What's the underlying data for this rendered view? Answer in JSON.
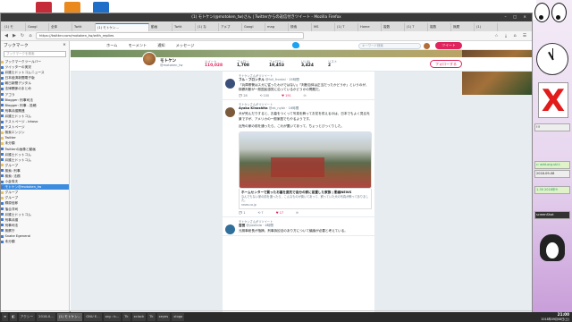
{
  "window": {
    "title": "(1) モトケン(@motoken_tw)さん | Twitterからの返信付きツイート - Mozilla Firefox",
    "controls": "– □ ×"
  },
  "tabs": [
    {
      "label": "(1) モ"
    },
    {
      "label": "Googl"
    },
    {
      "label": "全体"
    },
    {
      "label": "Twitt"
    },
    {
      "label": "(1) モトケン..."
    },
    {
      "label": "動画"
    },
    {
      "label": "Twitt"
    },
    {
      "label": "(1) な"
    },
    {
      "label": "アメブ"
    },
    {
      "label": "Googl"
    },
    {
      "label": "mag"
    },
    {
      "label": "検索"
    },
    {
      "label": "MS"
    },
    {
      "label": "(1) T"
    },
    {
      "label": "Home"
    },
    {
      "label": "複数"
    },
    {
      "label": "(1) T"
    },
    {
      "label": "複数"
    },
    {
      "label": "無題"
    },
    {
      "label": "(1) "
    }
  ],
  "navbar": {
    "url": "https://twitter.com/motoken_tw/with_replies",
    "back": "◀",
    "forward": "▶",
    "reload": "↻",
    "home": "⌂",
    "tools": "☆ ⤓ ⌂ ☰"
  },
  "sidebar": {
    "title": "ブックマーク",
    "close": "×",
    "search_placeholder": "ブックマークを検索",
    "items": [
      {
        "label": "ブックマークツールバー",
        "folder": true
      },
      {
        "label": "ツイッターの実況",
        "folder": false
      },
      {
        "label": "弁護士ドットコムニュース",
        "folder": false
      },
      {
        "label": "日本経済新聞電子版",
        "folder": false
      },
      {
        "label": "朝日新聞デジタル",
        "folder": false
      },
      {
        "label": "法律関係のまとめ",
        "folder": false
      },
      {
        "label": "アゴラ",
        "folder": false
      },
      {
        "label": "Blogger: 刑事司法",
        "folder": false
      },
      {
        "label": "Blogger: 刑事 - 投稿",
        "folder": false
      },
      {
        "label": "刑事弁護関連",
        "folder": false
      },
      {
        "label": "弁護士ドットコム",
        "folder": false
      },
      {
        "label": "テストページ - bhoso",
        "folder": false
      },
      {
        "label": "テストページ",
        "folder": false
      },
      {
        "label": "検索エンジン",
        "folder": true
      },
      {
        "label": "Twitter",
        "folder": true
      },
      {
        "label": "未分類",
        "folder": true
      },
      {
        "label": "Twitterの画像と動画",
        "folder": false
      },
      {
        "label": "弁護士ドットコム",
        "folder": false
      },
      {
        "label": "弁護士ドットコム",
        "folder": false
      },
      {
        "label": "グループ",
        "folder": true
      },
      {
        "label": "検索: 刑事",
        "folder": false
      },
      {
        "label": "検索: 法務",
        "folder": false
      },
      {
        "label": "小倉秀夫",
        "folder": false
      },
      {
        "label": "モトケン@motoken_tw",
        "folder": false,
        "selected": true
      },
      {
        "label": "グループ",
        "folder": true
      },
      {
        "label": "グループ",
        "folder": true
      },
      {
        "label": "郷原信郎",
        "folder": false
      },
      {
        "label": "落合洋司",
        "folder": false
      },
      {
        "label": "弁護士ドットコム",
        "folder": false
      },
      {
        "label": "刑事弁護",
        "folder": false
      },
      {
        "label": "刑事司法",
        "folder": false
      },
      {
        "label": "検察庁",
        "folder": false
      },
      {
        "label": "Snake Egeneral",
        "folder": false
      },
      {
        "label": "未分類",
        "folder": false
      }
    ]
  },
  "twitter": {
    "nav": {
      "home": "ホーム",
      "moments": "モーメント",
      "notifications": "通知",
      "messages": "メッセージ"
    },
    "search_placeholder": "キーワード検索",
    "tweet_button": "ツイート",
    "profile": {
      "name": "モトケン",
      "handle": "@motoken_tw"
    },
    "stats": [
      {
        "label": "ツイート",
        "value": "110,028"
      },
      {
        "label": "フォロー",
        "value": "1,708"
      },
      {
        "label": "フォロワー",
        "value": "19,453"
      },
      {
        "label": "いいね",
        "value": "3,424"
      },
      {
        "label": "リスト",
        "value": "2"
      }
    ],
    "follow_button": "フォローする",
    "tweets": [
      {
        "retweeted_by": "モトケンさんがリツイート",
        "author": "フル・フロンタル",
        "handle": "@full_frontal · 15時間",
        "text": "「兵庫県警はスガに従ったわけではない」「判断自体は正当だったかどうか」というのが、検察判断が一般国民感覚に沿っているかどうかの問題だ。",
        "replies": "28",
        "retweets": "100",
        "likes": "191",
        "avatar": "#3a4f7a"
      },
      {
        "retweeted_by": "モトケンさんがリツイート",
        "author": "Ayako Kinoshita",
        "handle": "@ak_nybk · 16時間",
        "text": "犬が死んだりすると、お墓をつくって写真を飾ってお花を供えるのは、日本でもよく見る光景ですが、アメリカの一般家庭でもやるようです。",
        "text2": "近所の家の前を通ったら、これが置いてあって、ちょっとびっくりした。",
        "card_title": "ホームセンターで買ったお墓を庭先で自分の家に設置した家族 | 動画NEWS",
        "card_desc": "なんでもない家の前を通ったら、こんなものが置いてあって、飼っていた犬の写真が飾ってありました。",
        "card_url": "news.co.jp",
        "replies": "1",
        "retweets": "7",
        "likes": "17",
        "avatar": "#7a5a3a"
      },
      {
        "retweeted_by": "モトケンさんがリツイート",
        "author": "吉田",
        "handle": "@yoshida · 4時間",
        "text": "元検事総長が指摘、刑事訴訟法のあり方について議論が必要と考えている。",
        "avatar": "#2f6f9a"
      }
    ]
  },
  "taskbar": {
    "items": [
      {
        "label": "≡"
      },
      {
        "label": "◧"
      },
      {
        "label": "アクシー"
      },
      {
        "label": "2018-0..."
      },
      {
        "label": "(1) モトケン..."
      },
      {
        "label": "GNU E..."
      },
      {
        "label": "org : b..."
      },
      {
        "label": "Tk"
      },
      {
        "label": "xclock"
      },
      {
        "label": "Tk"
      },
      {
        "label": "xeyes"
      },
      {
        "label": "xlogo"
      }
    ],
    "clock_time": "21:00",
    "clock_date": "2018年09月08日(土)"
  },
  "desktop": {
    "boxes": [
      "!!!",
      "c: add-org-skl-t",
      "2018-09-08",
      "1-30 2018年9",
      "screenShot"
    ]
  },
  "colors": {
    "accent": "#e0245e",
    "twitter_blue": "#1da1f2"
  }
}
